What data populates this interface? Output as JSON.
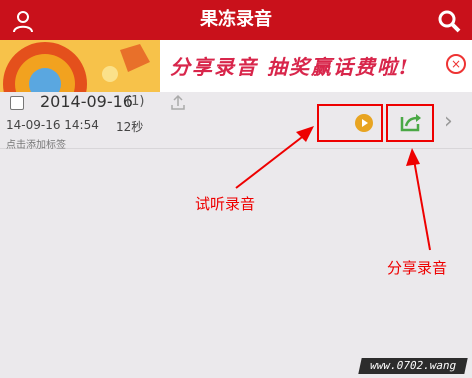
{
  "header": {
    "title": "果冻录音",
    "bg_color": "#c9111b",
    "user_icon": "user-icon",
    "search_icon": "search-icon"
  },
  "banner": {
    "text": "分享录音 抽奖赢话费啦!",
    "close_glyph": "×"
  },
  "recording": {
    "date": "2014-09-16",
    "count": "(1)",
    "datetime": "14-09-16 14:54",
    "duration": "12秒",
    "tag_hint": "点击添加标签"
  },
  "annotations": {
    "listen": "试听录音",
    "share": "分享录音",
    "color": "#ee0000"
  },
  "watermark": {
    "text": "www.0702.wang"
  }
}
